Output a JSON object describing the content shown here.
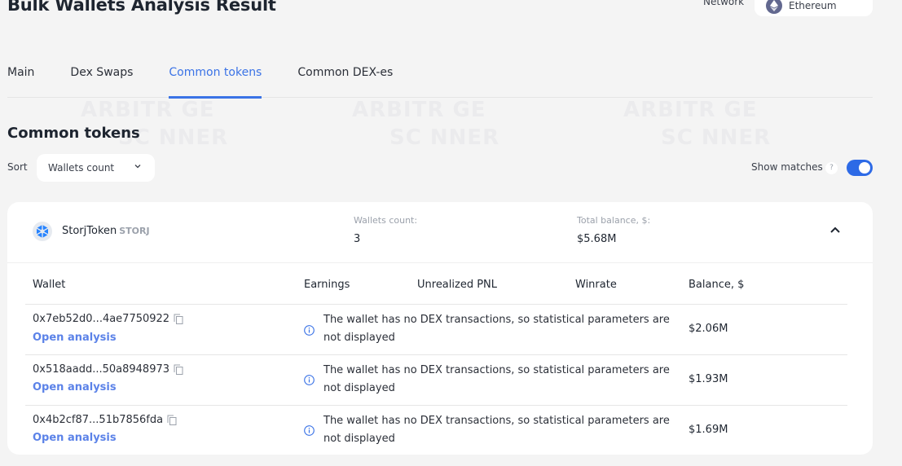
{
  "header": {
    "title": "Bulk Wallets Analysis Result",
    "network_label": "Network",
    "network_value": "Ethereum"
  },
  "tabs": [
    {
      "label": "Main",
      "active": false
    },
    {
      "label": "Dex Swaps",
      "active": false
    },
    {
      "label": "Common tokens",
      "active": true
    },
    {
      "label": "Common DEX-es",
      "active": false
    }
  ],
  "watermark": {
    "line1": "ARBITR GE",
    "line2": "SC NNER"
  },
  "section": {
    "title": "Common tokens",
    "sort_label": "Sort",
    "sort_value": "Wallets count",
    "show_matches_label": "Show matches",
    "help": "?",
    "show_matches_on": true
  },
  "token_card": {
    "name": "StorjToken",
    "symbol": "STORJ",
    "wallets_count_label": "Wallets count:",
    "wallets_count": "3",
    "total_balance_label": "Total balance, $:",
    "total_balance": "$5.68M",
    "expanded": true,
    "colors": {
      "token_icon": "#2683ff"
    }
  },
  "table": {
    "columns": [
      "Wallet",
      "Earnings",
      "Unrealized PNL",
      "Winrate",
      "Balance, $"
    ],
    "rows": [
      {
        "wallet": "0x7eb52d0...4ae7750922",
        "link": "Open analysis",
        "message": "The wallet has no DEX transactions, so statistical parameters are not displayed",
        "balance": "$2.06M"
      },
      {
        "wallet": "0x518aadd...50a8948973",
        "link": "Open analysis",
        "message": "The wallet has no DEX transactions, so statistical parameters are not displayed",
        "balance": "$1.93M"
      },
      {
        "wallet": "0x4b2cf87...51b7856fda",
        "link": "Open analysis",
        "message": "The wallet has no DEX transactions, so statistical parameters are not displayed",
        "balance": "$1.69M"
      }
    ]
  },
  "colors": {
    "accent": "#3b73e6",
    "link": "#5b82e8",
    "toggle": "#2d6ae6",
    "background": "#f4f4f4"
  }
}
